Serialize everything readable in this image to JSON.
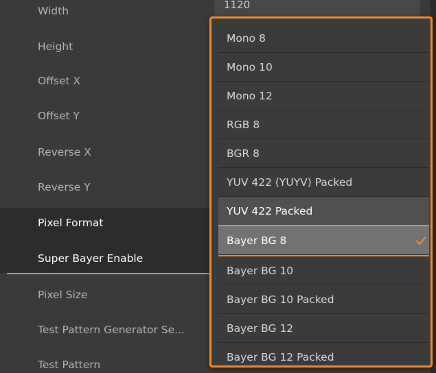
{
  "properties": [
    {
      "label": "Width"
    },
    {
      "label": "Height"
    },
    {
      "label": "Offset X"
    },
    {
      "label": "Offset Y"
    },
    {
      "label": "Reverse X"
    },
    {
      "label": "Reverse Y"
    },
    {
      "label": "Pixel Format"
    },
    {
      "label": "Super Bayer Enable"
    },
    {
      "label": "Pixel Size"
    },
    {
      "label": "Test Pattern Generator Se..."
    },
    {
      "label": "Test Pattern"
    }
  ],
  "width_value": "1120",
  "pixel_format_dropdown": {
    "selected": "Bayer BG 8",
    "options": [
      {
        "label": "Mono 8"
      },
      {
        "label": "Mono 10"
      },
      {
        "label": "Mono 12"
      },
      {
        "label": "RGB 8"
      },
      {
        "label": "BGR 8"
      },
      {
        "label": "YUV 422 (YUYV) Packed"
      },
      {
        "label": "YUV 422 Packed"
      },
      {
        "label": "Bayer BG 8"
      },
      {
        "label": "Bayer BG 10"
      },
      {
        "label": "Bayer BG 10 Packed"
      },
      {
        "label": "Bayer BG 12"
      },
      {
        "label": "Bayer BG 12 Packed"
      }
    ]
  },
  "colors": {
    "accent": "#f0892e",
    "panel_bg": "#3a3a3a",
    "selected_bg": "#727272",
    "hover_bg": "#505050"
  },
  "icons": {
    "selected_check": "check-icon"
  }
}
